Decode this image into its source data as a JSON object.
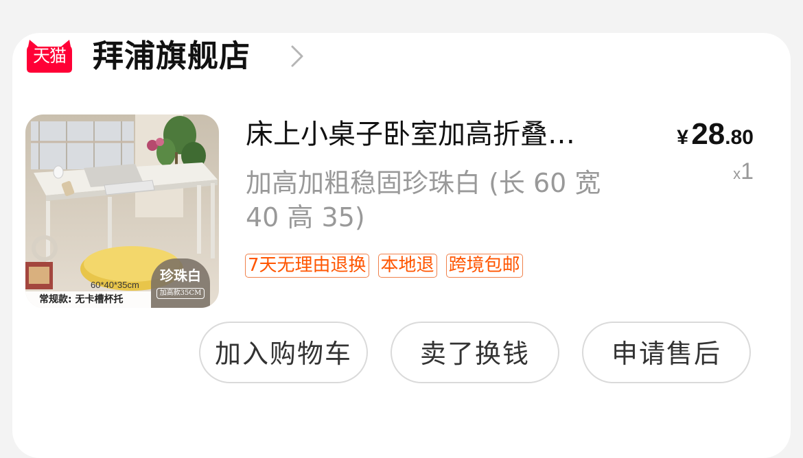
{
  "shop": {
    "platform_logo_text": "天猫",
    "name": "拜浦旗舰店",
    "chevron_icon": "chevron-right-icon"
  },
  "product": {
    "title": "床上小桌子卧室加高折叠…",
    "price": {
      "currency": "¥",
      "integer": "28",
      "decimal": ".80"
    },
    "quantity": {
      "prefix": "x",
      "count": "1"
    },
    "spec": "加高加粗稳固珍珠白 (长 60 宽 40 高 35)",
    "image": {
      "size_label": "60*40*35cm",
      "caption": "常规款: 无卡槽杯托",
      "badge_main": "珍珠白",
      "badge_sub": "加高款35CM"
    },
    "tags": [
      "7天无理由退换",
      "本地退",
      "跨境包邮"
    ]
  },
  "actions": {
    "add_to_cart": "加入购物车",
    "resell": "卖了换钱",
    "after_sales": "申请售后"
  },
  "colors": {
    "brand_red": "#ff0036",
    "tag_orange": "#ff5500",
    "muted_gray": "#999999"
  }
}
